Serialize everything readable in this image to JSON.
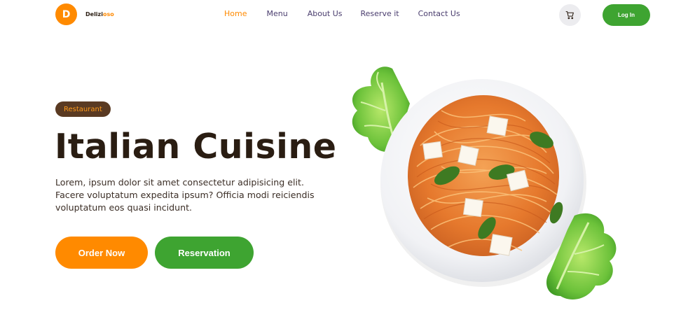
{
  "brand": {
    "initial": "D",
    "name_part1": "Delizi",
    "name_part2": "oso"
  },
  "nav": {
    "items": [
      {
        "label": "Home",
        "active": true
      },
      {
        "label": "Menu",
        "active": false
      },
      {
        "label": "About Us",
        "active": false
      },
      {
        "label": "Reserve it",
        "active": false
      },
      {
        "label": "Contact Us",
        "active": false
      }
    ],
    "login_label": "Log In",
    "cart_icon": "cart-icon"
  },
  "hero": {
    "badge": "Restaurant",
    "title": "Italian Cuisine",
    "description": "Lorem, ipsum dolor sit amet consectetur adipisicing elit. Facere voluptatum expedita ipsum? Officia modi reiciendis voluptatum eos quasi incidunt.",
    "order_label": "Order Now",
    "reservation_label": "Reservation",
    "image": "spaghetti-plate-image"
  },
  "colors": {
    "accent_orange": "#ff8a00",
    "accent_green": "#3ea431",
    "badge_brown": "#5a3a22",
    "text_dark": "#2a1d12",
    "nav_text": "#4a3d6e"
  }
}
